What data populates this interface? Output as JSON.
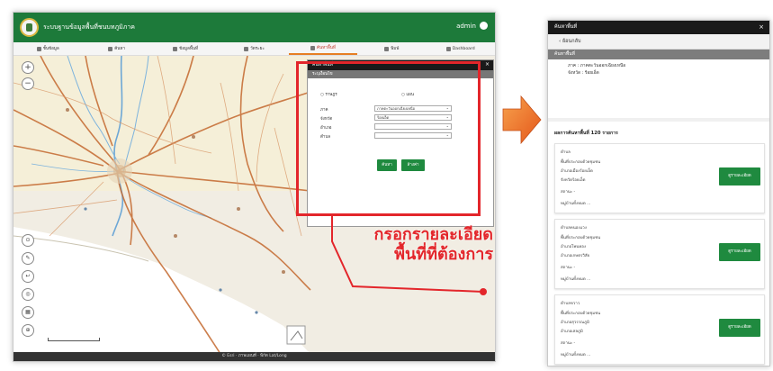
{
  "app": {
    "title": "ระบบฐานข้อมูลพื้นที่ชนบทภูมิภาค",
    "user_label": "admin"
  },
  "menu": [
    {
      "label": "ชั้นข้อมูล",
      "active": false
    },
    {
      "label": "ค้นหา",
      "active": false
    },
    {
      "label": "ข้อมูลพื้นที่",
      "active": false
    },
    {
      "label": "วัดระยะ",
      "active": false
    },
    {
      "label": "ค้นหาพื้นที่",
      "active": true
    },
    {
      "label": "พิมพ์",
      "active": false
    },
    {
      "label": "Dashboard",
      "active": false
    }
  ],
  "status_bar": "© Esri · ภาพแผนที่ · พิกัด Lat/Long",
  "dialog": {
    "title": "ค้นหาพื้นที่",
    "subtitle": "ระบุเงื่อนไข",
    "type_options": [
      "ราษฎร",
      "แผน"
    ],
    "fields": [
      {
        "label": "ภาค",
        "value": "ภาคตะวันออกเฉียงเหนือ"
      },
      {
        "label": "จังหวัด",
        "value": "ร้อยเอ็ด"
      },
      {
        "label": "อำเภอ",
        "value": ""
      },
      {
        "label": "ตำบล",
        "value": ""
      }
    ],
    "search_button": "ค้นหา",
    "clear_button": "ล้างค่า"
  },
  "callout": {
    "line1": "กรอกรายละเอียด",
    "line2": "พื้นที่ที่ต้องการ",
    "color": "#e3262b"
  },
  "result_panel": {
    "title": "ค้นหาพื้นที่",
    "back_label": "ย้อนกลับ",
    "criteria_title": "ค้นหาพื้นที่",
    "criteria": [
      "ภาค : ภาคตะวันออกเฉียงเหนือ",
      "จังหวัด : ร้อยเอ็ด"
    ],
    "count_heading": "ผลการค้นหาพื้นที่ 120 รายการ",
    "detail_button": "ดูรายละเอียด",
    "results": [
      {
        "lines": [
          "ตำบล",
          "พื้นที่ประกอบด้วยชุมชน",
          "อำเภอเมืองร้อยเอ็ด",
          "จังหวัดร้อยเอ็ด",
          "สถานะ -",
          "หมู่บ้านทั้งหมด ..."
        ]
      },
      {
        "lines": [
          "ตำบลหนองแวง",
          "พื้นที่ประกอบด้วยชุมชน",
          "อำเภอโพนทอง",
          "อำเภอเกษตรวิสัย",
          "สถานะ -",
          "หมู่บ้านทั้งหมด ..."
        ]
      },
      {
        "lines": [
          "ตำบลขวาว",
          "พื้นที่ประกอบด้วยชุมชน",
          "อำเภอสุวรรณภูมิ",
          "อำเภอเสลภูมิ",
          "สถานะ -",
          "หมู่บ้านทั้งหมด ..."
        ]
      }
    ]
  },
  "colors": {
    "header_green": "#1d7a3a",
    "button_green": "#1f8a3f",
    "arrow_orange": "#ef6c1f"
  }
}
